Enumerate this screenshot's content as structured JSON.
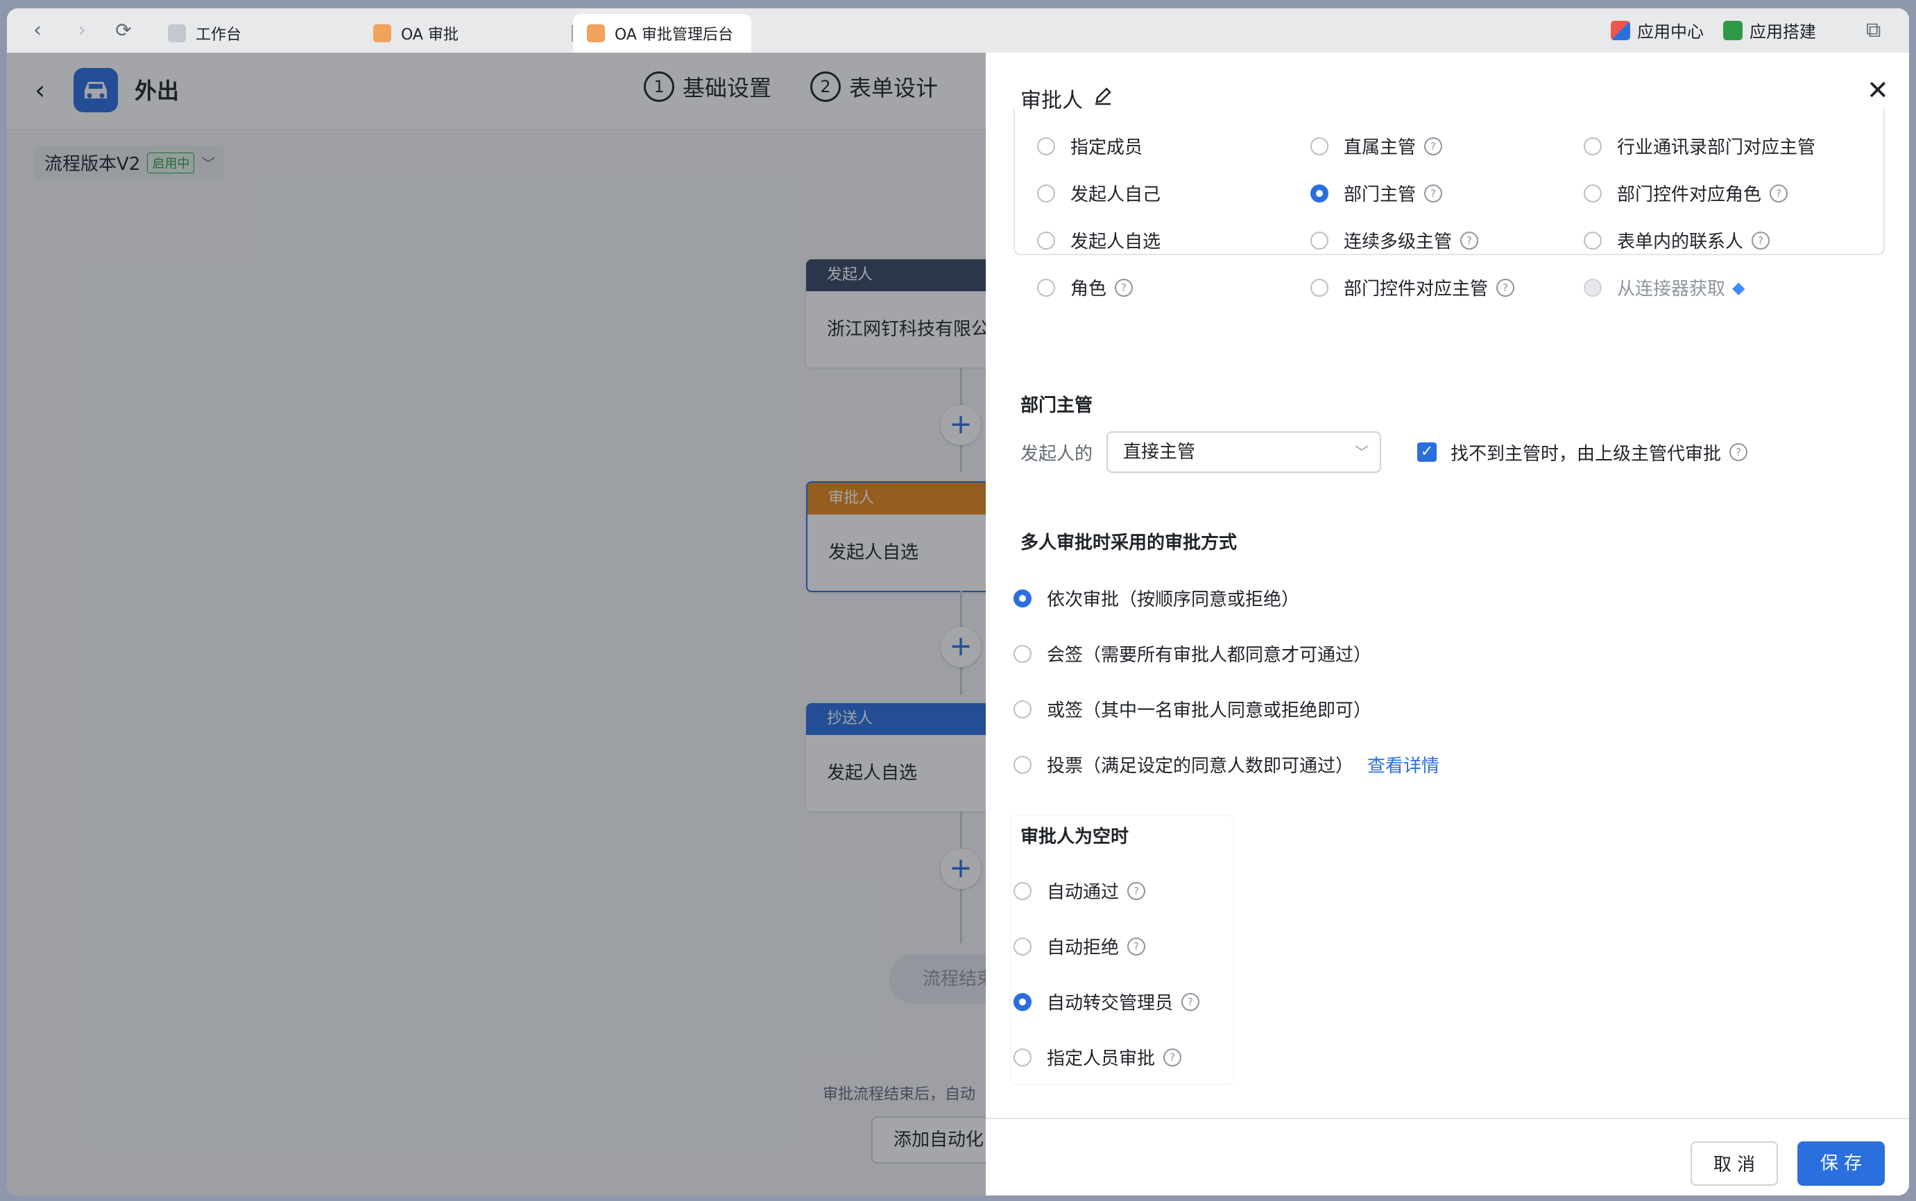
{
  "browser": {
    "tabs": [
      {
        "label": "工作台"
      },
      {
        "label": "OA 审批"
      },
      {
        "label": "OA 审批管理后台"
      }
    ],
    "app_center": "应用中心",
    "app_builder": "应用搭建"
  },
  "app": {
    "title": "外出",
    "steps": [
      {
        "num": "1",
        "label": "基础设置"
      },
      {
        "num": "2",
        "label": "表单设计"
      }
    ],
    "version_label": "流程版本V2",
    "version_badge": "启用中"
  },
  "flow": {
    "nodes": [
      {
        "header": "发起人",
        "body": "浙江网钉科技有限公",
        "color": "#3a4763"
      },
      {
        "header": "审批人",
        "body": "发起人自选",
        "color": "#e8891c"
      },
      {
        "header": "抄送人",
        "body": "发起人自选",
        "color": "#2b6fde"
      }
    ],
    "end_label": "流程结束",
    "automation_hint": "审批流程结束后，自动",
    "automation_button": "添加自动化"
  },
  "drawer": {
    "title": "审批人",
    "approver_types": [
      {
        "label": "指定成员",
        "checked": false,
        "help": false,
        "disabled": false
      },
      {
        "label": "直属主管",
        "checked": false,
        "help": true,
        "disabled": false
      },
      {
        "label": "行业通讯录部门对应主管",
        "checked": false,
        "help": false,
        "disabled": false
      },
      {
        "label": "发起人自己",
        "checked": false,
        "help": false,
        "disabled": false
      },
      {
        "label": "部门主管",
        "checked": true,
        "help": true,
        "disabled": false
      },
      {
        "label": "部门控件对应角色",
        "checked": false,
        "help": true,
        "disabled": false
      },
      {
        "label": "发起人自选",
        "checked": false,
        "help": false,
        "disabled": false
      },
      {
        "label": "连续多级主管",
        "checked": false,
        "help": true,
        "disabled": false
      },
      {
        "label": "表单内的联系人",
        "checked": false,
        "help": true,
        "disabled": false
      },
      {
        "label": "角色",
        "checked": false,
        "help": true,
        "disabled": false
      },
      {
        "label": "部门控件对应主管",
        "checked": false,
        "help": true,
        "disabled": false
      },
      {
        "label": "从连接器获取",
        "checked": false,
        "help": false,
        "disabled": true
      }
    ],
    "dept_section_title": "部门主管",
    "dept_prefix": "发起人的",
    "dept_select_value": "直接主管",
    "fallback_checkbox": "找不到主管时，由上级主管代审批",
    "multi_section_title": "多人审批时采用的审批方式",
    "multi_options": [
      {
        "label": "依次审批（按顺序同意或拒绝）",
        "checked": true
      },
      {
        "label": "会签（需要所有审批人都同意才可通过）",
        "checked": false
      },
      {
        "label": "或签（其中一名审批人同意或拒绝即可）",
        "checked": false
      },
      {
        "label": "投票（满足设定的同意人数即可通过）",
        "checked": false
      }
    ],
    "vote_link": "查看详情",
    "empty_section_title": "审批人为空时",
    "empty_options": [
      {
        "label": "自动通过",
        "checked": false
      },
      {
        "label": "自动拒绝",
        "checked": false
      },
      {
        "label": "自动转交管理员",
        "checked": true
      },
      {
        "label": "指定人员审批",
        "checked": false
      }
    ],
    "cancel": "取 消",
    "save": "保 存"
  },
  "icons": [
    "back-icon",
    "forward-icon",
    "refresh-icon",
    "edit-icon",
    "close-icon",
    "help-icon",
    "gem-icon",
    "chevron-down-icon",
    "car-icon",
    "plus-icon"
  ]
}
